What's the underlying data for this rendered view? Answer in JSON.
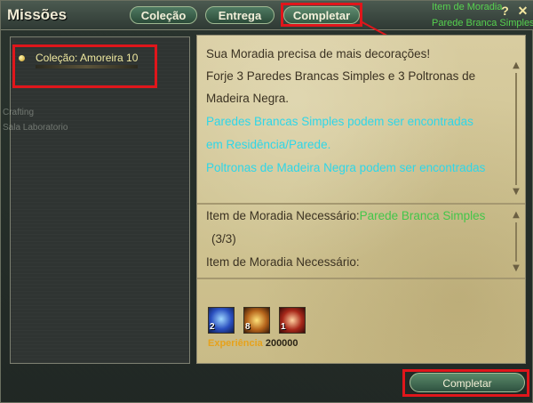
{
  "window": {
    "title": "Missões"
  },
  "tabs": [
    {
      "label": "Coleção"
    },
    {
      "label": "Entrega"
    },
    {
      "label": "Completar"
    }
  ],
  "controls": {
    "help": "?",
    "close": "✕"
  },
  "background_text": [
    "Item de Moradia",
    "Parede Branca Simples",
    "Crafting",
    "Sala Laboratorio"
  ],
  "quest_list": [
    {
      "label": "Coleção: Amoreira 10"
    }
  ],
  "description": {
    "lines": [
      "Sua Moradia precisa de mais decorações!",
      "Forje 3 Paredes Brancas Simples e 3 Poltronas de",
      "Madeira Negra."
    ],
    "hints": [
      "Paredes Brancas Simples podem ser encontradas",
      "em Residência/Parede.",
      "Poltronas de Madeira Negra podem ser encontradas"
    ]
  },
  "requirements": [
    {
      "label": "Item de Moradia Necessário:",
      "item": "Parede Branca Simples",
      "progress": "(3/3)"
    },
    {
      "label": "Item de Moradia Necessário:",
      "item": "",
      "progress": ""
    }
  ],
  "rewards": {
    "icons": [
      {
        "name": "scroll-item-icon",
        "count": "2",
        "color": "#2a4fbf"
      },
      {
        "name": "fire-orb-icon",
        "count": "8",
        "color": "#b5641b"
      },
      {
        "name": "flame-burst-icon",
        "count": "1",
        "color": "#a8281a"
      }
    ],
    "exp_label": "Experiência",
    "exp_value": "200000"
  },
  "bottom_button": {
    "label": "Completar"
  },
  "colors": {
    "cyan_hint": "#2fd6e8",
    "green_item": "#43c64a",
    "highlight": "#e0161b"
  }
}
